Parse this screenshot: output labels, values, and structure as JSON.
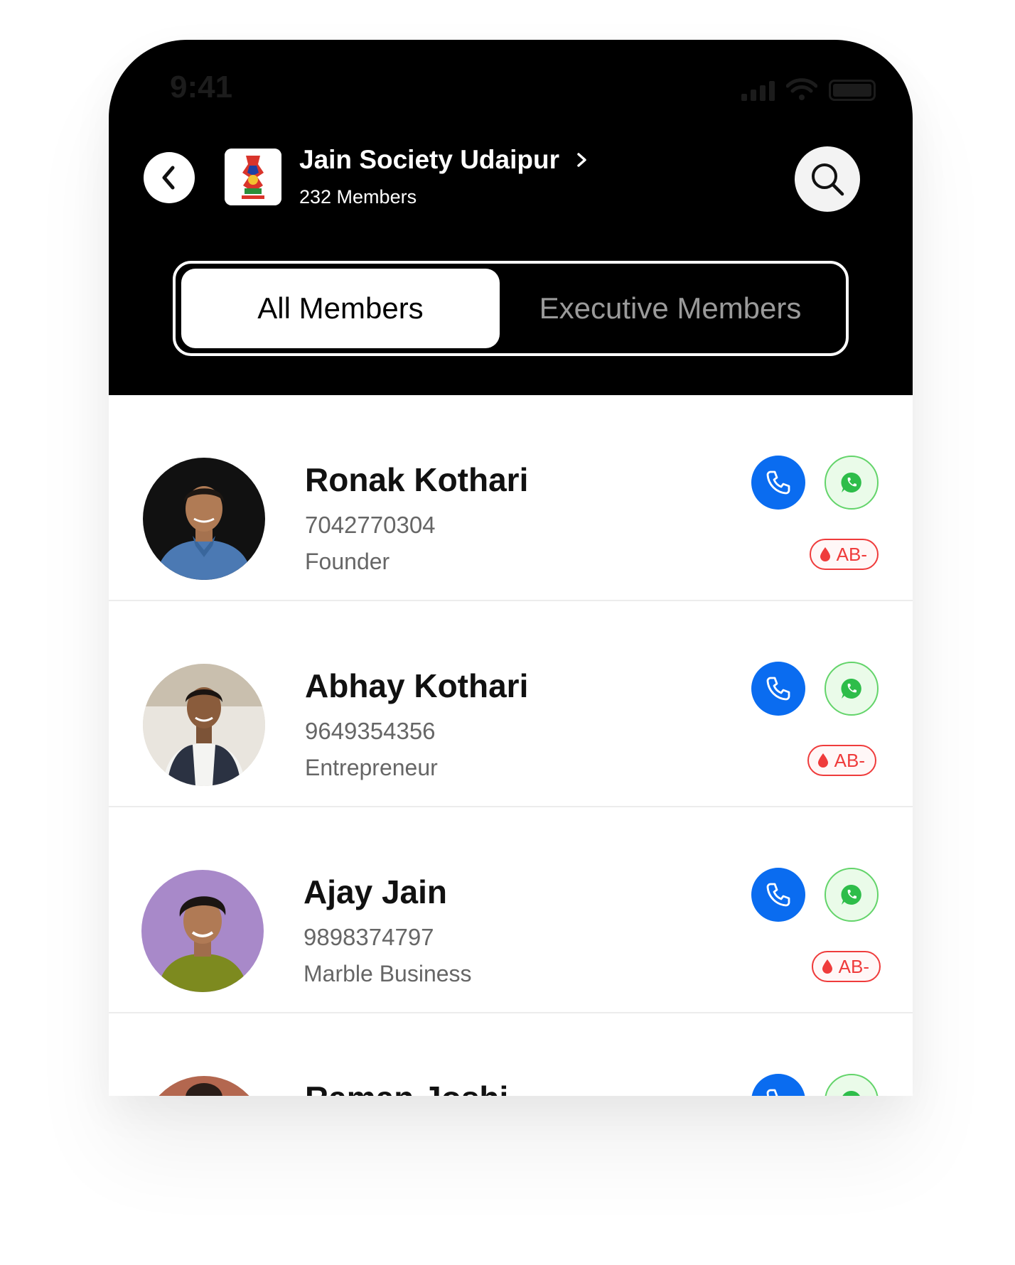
{
  "status_bar": {
    "time": "9:41"
  },
  "header": {
    "group_name": "Jain Society Udaipur",
    "member_count": "232 Members"
  },
  "tabs": [
    {
      "label": "All Members",
      "active": true
    },
    {
      "label": "Executive Members",
      "active": false
    }
  ],
  "members": [
    {
      "name": "Ronak Kothari",
      "phone": "7042770304",
      "role": "Founder",
      "blood_group": "AB-"
    },
    {
      "name": "Abhay Kothari",
      "phone": "9649354356",
      "role": "Entrepreneur",
      "blood_group": "AB-"
    },
    {
      "name": "Ajay Jain",
      "phone": "9898374797",
      "role": "Marble Business",
      "blood_group": "AB-"
    },
    {
      "name": "Raman Joshi",
      "phone": "",
      "role": "",
      "blood_group": ""
    }
  ],
  "colors": {
    "call": "#0a6cf0",
    "whatsapp": "#2ebd4a",
    "blood": "#ef3b3b"
  }
}
